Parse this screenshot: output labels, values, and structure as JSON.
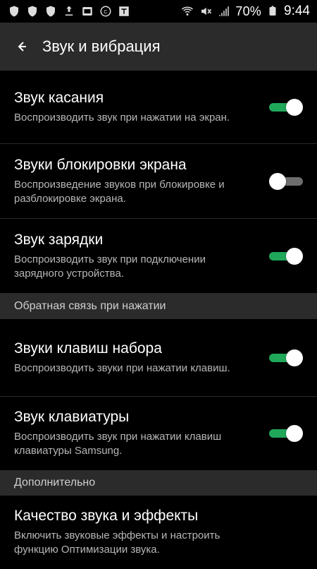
{
  "status": {
    "battery": "70%",
    "time": "9:44",
    "icons_left": [
      "shield-icon",
      "shield-icon",
      "shield-icon",
      "download-icon",
      "image-icon",
      "copyright-icon",
      "tt-icon"
    ],
    "icons_right": [
      "wifi-icon",
      "mute-icon",
      "signal-icon",
      "battery-icon"
    ]
  },
  "header": {
    "title": "Звук и вибрация"
  },
  "items": [
    {
      "title": "Звук касания",
      "subtitle": "Воспроизводить звук при нажатии на экран.",
      "toggle": "on"
    },
    {
      "title": "Звуки блокировки экрана",
      "subtitle": "Воспроизведение звуков при блокировке и разблокировке экрана.",
      "toggle": "off"
    },
    {
      "title": "Звук зарядки",
      "subtitle": "Воспроизводить звук при подключении зарядного устройства.",
      "toggle": "on"
    }
  ],
  "sections": [
    {
      "label": "Обратная связь при нажатии"
    },
    {
      "label": "Дополнительно"
    }
  ],
  "items2": [
    {
      "title": "Звуки клавиш набора",
      "subtitle": "Воспроизводить звуки при нажатии клавиш.",
      "toggle": "on"
    },
    {
      "title": "Звук клавиатуры",
      "subtitle": "Воспроизводить звук при нажатии клавиш клавиатуры Samsung.",
      "toggle": "on"
    }
  ],
  "items3": [
    {
      "title": "Качество звука и эффекты",
      "subtitle": "Включить звуковые эффекты и настроить функцию Оптимизации звука."
    }
  ],
  "colors": {
    "accent": "#20a85a",
    "header_bg": "#2b2b2b",
    "text_secondary": "#b7b7b7"
  }
}
